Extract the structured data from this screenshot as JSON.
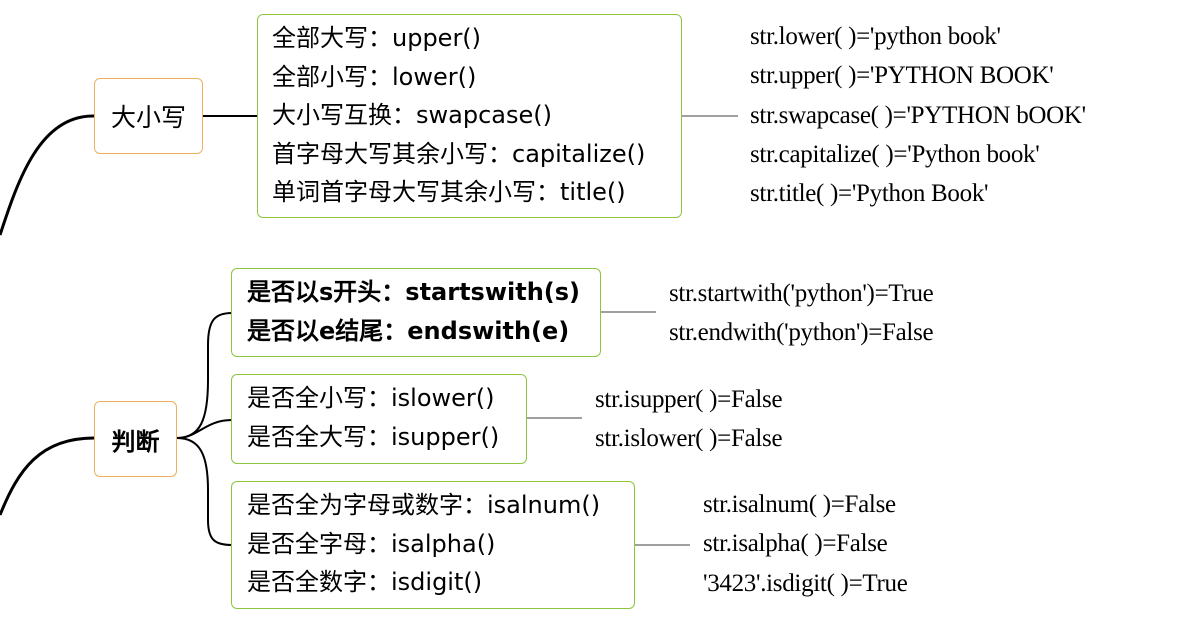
{
  "nodes": {
    "case": {
      "label": "大小写"
    },
    "judge": {
      "label": "判断"
    }
  },
  "case_box": {
    "lines": [
      "全部大写：upper()",
      "全部小写：lower()",
      "大小写互换：swapcase()",
      "首字母大写其余小写：capitalize()",
      "单词首字母大写其余小写：title()"
    ]
  },
  "case_examples": {
    "lines": [
      "str.lower( )='python book'",
      "str.upper( )='PYTHON BOOK'",
      "str.swapcase( )='PYTHON bOOK'",
      "str.capitalize( )='Python book'",
      "str.title( )='Python Book'"
    ]
  },
  "startend_box": {
    "lines": [
      "是否以s开头：startswith(s)",
      "是否以e结尾：endswith(e)"
    ]
  },
  "startend_examples": {
    "lines": [
      "str.startwith('python')=True",
      "str.endwith('python')=False"
    ]
  },
  "lowerupper_box": {
    "lines": [
      "是否全小写：islower()",
      "是否全大写：isupper()"
    ]
  },
  "lowerupper_examples": {
    "lines": [
      "str.isupper( )=False",
      "str.islower( )=False"
    ]
  },
  "alnum_box": {
    "lines": [
      "是否全为字母或数字：isalnum()",
      "是否全字母：isalpha()",
      "是否全数字：isdigit()"
    ]
  },
  "alnum_examples": {
    "lines": [
      "str.isalnum( )=False",
      "str.isalpha( )=False",
      "'3423'.isdigit( )=True"
    ]
  },
  "colors": {
    "topic_border": "#f0b060",
    "box_border": "#8cc63f",
    "connector": "#000000",
    "leader": "#a0a0a0"
  }
}
